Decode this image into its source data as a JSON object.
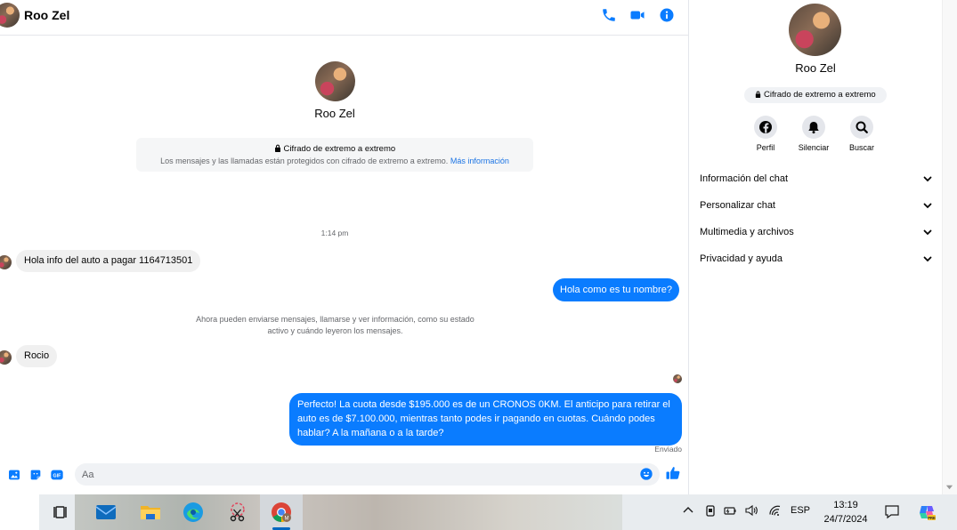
{
  "chat": {
    "contact_name": "Roo Zel",
    "e2e_title": "Cifrado de extremo a extremo",
    "e2e_body": "Los mensajes y las llamadas están protegidos con cifrado de extremo a extremo.",
    "e2e_link": "Más información",
    "time_separator": "1:14 pm",
    "system_note_line1": "Ahora pueden enviarse mensajes, llamarse y ver información, como su estado",
    "system_note_line2": "activo y cuándo leyeron los mensajes.",
    "messages": [
      {
        "direction": "in",
        "text": "Hola info del auto a pagar 1164713501"
      },
      {
        "direction": "out",
        "text": "Hola como es tu nombre?"
      },
      {
        "direction": "in",
        "text": "Rocio"
      },
      {
        "direction": "out",
        "text": "Perfecto! La cuota desde $195.000 es de un CRONOS 0KM. El anticipo para retirar el auto es de $7.100.000, mientras tanto podes ir pagando en cuotas. Cuándo podes hablar? A la mañana o a la tarde?"
      }
    ],
    "status": "Enviado",
    "composer_placeholder": "Aa",
    "icons": {
      "header": [
        "phone-icon",
        "video-camera-icon",
        "info-icon"
      ],
      "composer": [
        "photo-icon",
        "sticker-icon",
        "gif-icon",
        "emoji-icon",
        "thumbs-up-icon"
      ]
    }
  },
  "panel": {
    "name": "Roo Zel",
    "e2e_badge": "Cifrado de extremo a extremo",
    "actions": [
      {
        "label": "Perfil",
        "icon": "facebook-profile-icon"
      },
      {
        "label": "Silenciar",
        "icon": "bell-icon"
      },
      {
        "label": "Buscar",
        "icon": "search-icon"
      }
    ],
    "sections": [
      "Información del chat",
      "Personalizar chat",
      "Multimedia y archivos",
      "Privacidad y ayuda"
    ]
  },
  "taskbar": {
    "apps": [
      "task-view-icon",
      "mail-icon",
      "file-explorer-icon",
      "edge-icon",
      "snipping-tool-icon",
      "chrome-icon"
    ],
    "language": "ESP",
    "time": "13:19",
    "date": "24/7/2024"
  },
  "colors": {
    "accent": "#0a7cff",
    "link": "#1b74e4",
    "incoming_bubble": "#f0f0f0",
    "taskbar": "#e8ecef"
  }
}
